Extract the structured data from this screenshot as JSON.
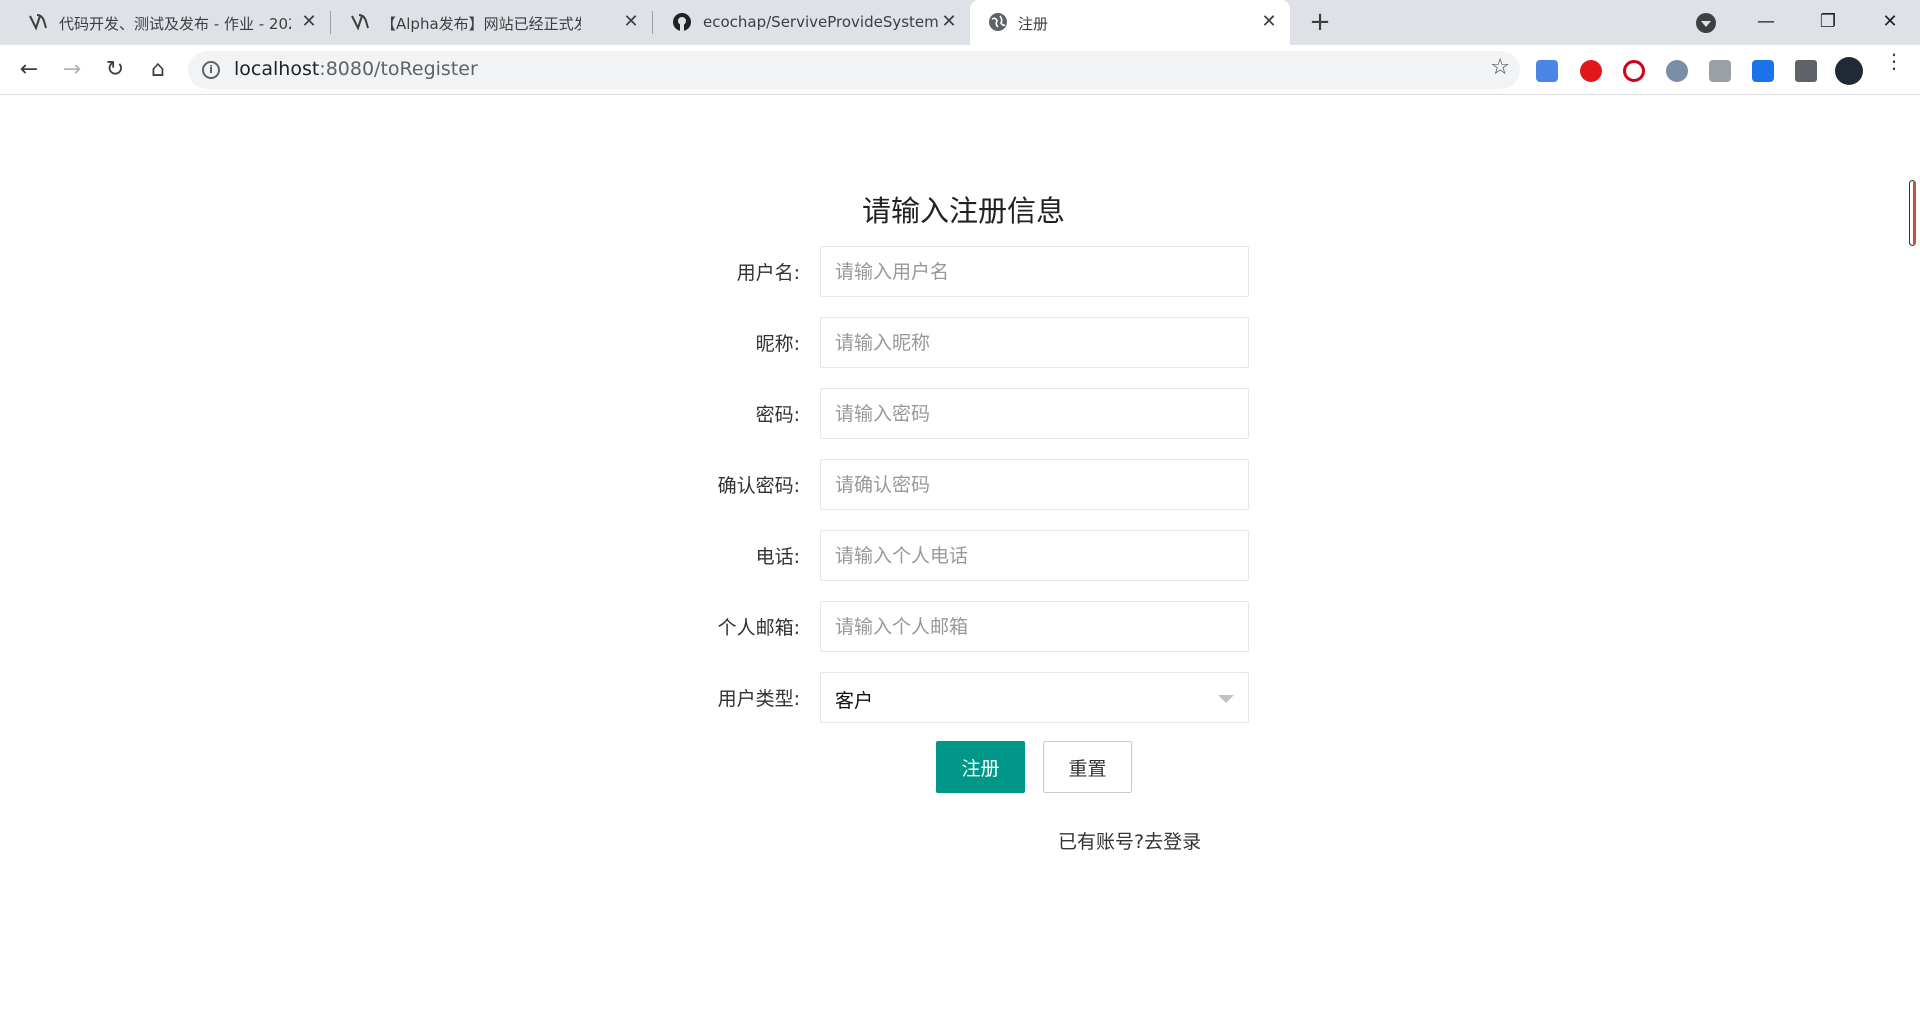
{
  "browser": {
    "tabs": [
      {
        "title": "代码开发、测试及发布 - 作业 - 202",
        "icon": "cnblogs-icon"
      },
      {
        "title": "【Alpha发布】网站已经正式发布！",
        "icon": "cnblogs-icon"
      },
      {
        "title": "ecochap/ServiveProvideSystem",
        "icon": "github-icon"
      },
      {
        "title": "注册",
        "icon": "globe-icon"
      }
    ],
    "address": {
      "host": "localhost",
      "path": ":8080/toRegister"
    },
    "colors": {
      "tabbar": "#dee1e6",
      "accent": "#009688"
    }
  },
  "form": {
    "title": "请输入注册信息",
    "fields": [
      {
        "label": "用户名:",
        "placeholder": "请输入用户名"
      },
      {
        "label": "昵称:",
        "placeholder": "请输入昵称"
      },
      {
        "label": "密码:",
        "placeholder": "请输入密码"
      },
      {
        "label": "确认密码:",
        "placeholder": "请确认密码"
      },
      {
        "label": "电话:",
        "placeholder": "请输入个人电话"
      },
      {
        "label": "个人邮箱:",
        "placeholder": "请输入个人邮箱"
      }
    ],
    "user_type": {
      "label": "用户类型:",
      "value": "客户"
    },
    "submit_label": "注册",
    "reset_label": "重置",
    "login_prompt": "已有账号?",
    "login_link": "去登录"
  }
}
